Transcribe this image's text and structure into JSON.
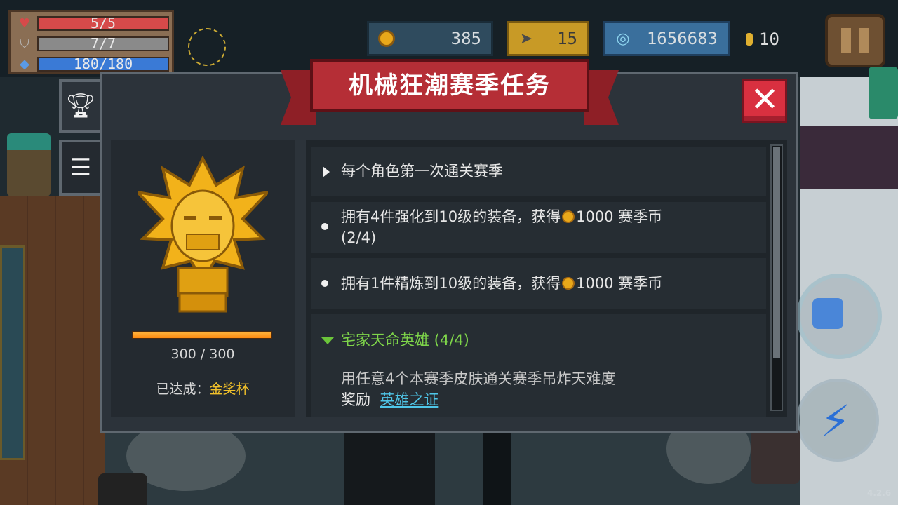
{
  "hud": {
    "health": "5/5",
    "armor": "7/7",
    "energy": "180/180",
    "coins": "385",
    "fish": "15",
    "gems": "1656683",
    "small_coins": "10"
  },
  "modal": {
    "title": "机械狂潮赛季任务",
    "progress_current": 300,
    "progress_max": 300,
    "progress_text": "300 / 300",
    "achieved_label": "已达成：",
    "achieved_value": "金奖杯"
  },
  "quests": [
    {
      "text": "每个角色第一次通关赛季",
      "marker": "triangle-right"
    },
    {
      "text_before": "拥有4件强化到10级的装备，获得",
      "coin_amount": "1000 赛季币",
      "progress": "(2/4)",
      "marker": "dot"
    },
    {
      "text_before": "拥有1件精炼到10级的装备，获得",
      "coin_amount": "1000 赛季币",
      "marker": "dot"
    },
    {
      "text": "宅家天命英雄 (4/4)",
      "marker": "triangle-down",
      "description": "用任意4个本赛季皮肤通关赛季吊炸天难度",
      "reward_label": "奖励",
      "reward_value": "英雄之证"
    }
  ],
  "icons": {
    "heart": "heart-icon",
    "shield": "shield-icon",
    "energy": "diamond-icon",
    "coin": "coin-icon",
    "fish": "fish-icon",
    "gem": "gem-icon",
    "trophy_tab": "trophy-icon",
    "list_tab": "list-icon",
    "close": "close-icon",
    "pause": "pause-icon"
  },
  "colors": {
    "health_bar": "#d64a4a",
    "armor_bar": "#8a8a8a",
    "energy_bar": "#3a7ad6",
    "banner": "#b52e36",
    "close_button": "#d93040",
    "gold_text": "#f2c12a",
    "quest_green": "#7ed54a",
    "reward_link": "#4fc6e8"
  },
  "version": "4.2.6"
}
